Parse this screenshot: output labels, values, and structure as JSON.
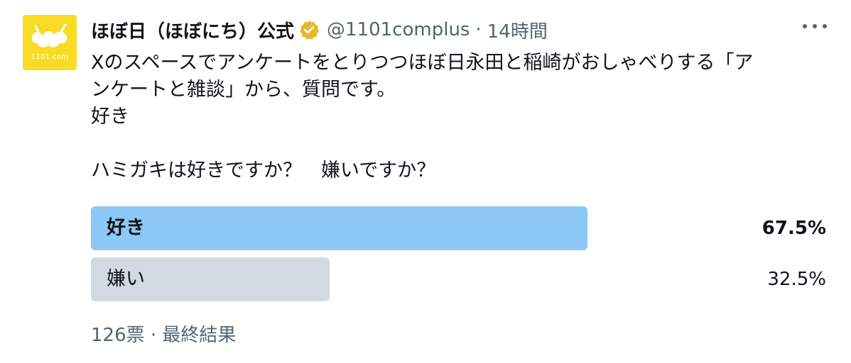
{
  "account": {
    "avatar_text": "1101.com",
    "display_name": "ほぼ日（ほぼにち）公式",
    "handle": "@1101complus",
    "separator": "·",
    "time": "14時間"
  },
  "tweet": {
    "lines": [
      "Xのスペースでアンケートをとりつつほぼ日永田と稲崎がおしゃべりする「ア",
      "ンケートと雑談」から、質問です。",
      "好き",
      "",
      "ハミガキは好きですか？　嫌いですか？"
    ]
  },
  "poll": {
    "options": [
      {
        "label": "好き",
        "percent_text": "67.5%",
        "share": 0.675,
        "winner": true
      },
      {
        "label": "嫌い",
        "percent_text": "32.5%",
        "share": 0.325,
        "winner": false
      }
    ],
    "footer": "126票 · 最終結果"
  },
  "colors": {
    "winner_bar": "#8ec8f6",
    "loser_bar": "#d2d9e0",
    "avatar_bg": "#f8dc24",
    "verified_badge": "#e8b829"
  },
  "icons": {
    "verified": "verified-badge-icon",
    "more": "more-options-icon"
  }
}
